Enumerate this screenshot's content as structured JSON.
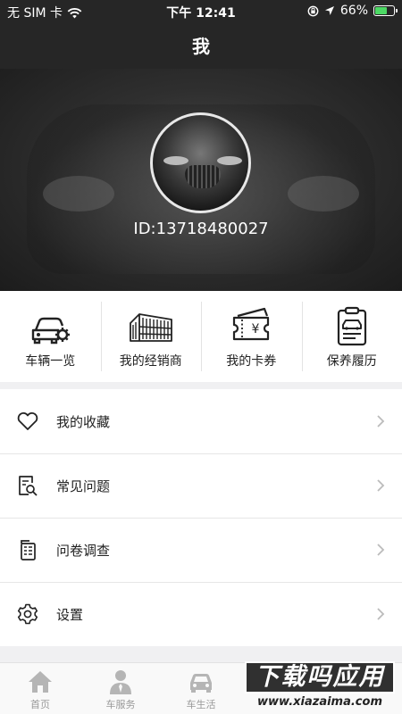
{
  "status_bar": {
    "carrier": "无 SIM 卡",
    "time": "下午 12:41",
    "battery_percent": "66%",
    "battery_level": 0.66,
    "battery_color": "#4cd964"
  },
  "nav": {
    "title": "我"
  },
  "profile": {
    "id_text": "ID:13718480027"
  },
  "quick_menu": [
    {
      "label": "车辆一览",
      "icon": "car-gear-icon"
    },
    {
      "label": "我的经销商",
      "icon": "dealer-building-icon"
    },
    {
      "label": "我的卡券",
      "icon": "coupon-ticket-icon"
    },
    {
      "label": "保养履历",
      "icon": "maintenance-clipboard-icon"
    }
  ],
  "menu_list": [
    {
      "label": "我的收藏",
      "icon": "heart-icon"
    },
    {
      "label": "常见问题",
      "icon": "faq-search-document-icon"
    },
    {
      "label": "问卷调查",
      "icon": "survey-document-icon"
    },
    {
      "label": "设置",
      "icon": "gear-icon"
    }
  ],
  "tab_bar": [
    {
      "label": "首页",
      "icon": "home-icon"
    },
    {
      "label": "车服务",
      "icon": "service-person-icon"
    },
    {
      "label": "车生活",
      "icon": "car-icon"
    }
  ],
  "watermark": {
    "main": "下载吗应用",
    "url": "www.xiazaima.com"
  }
}
